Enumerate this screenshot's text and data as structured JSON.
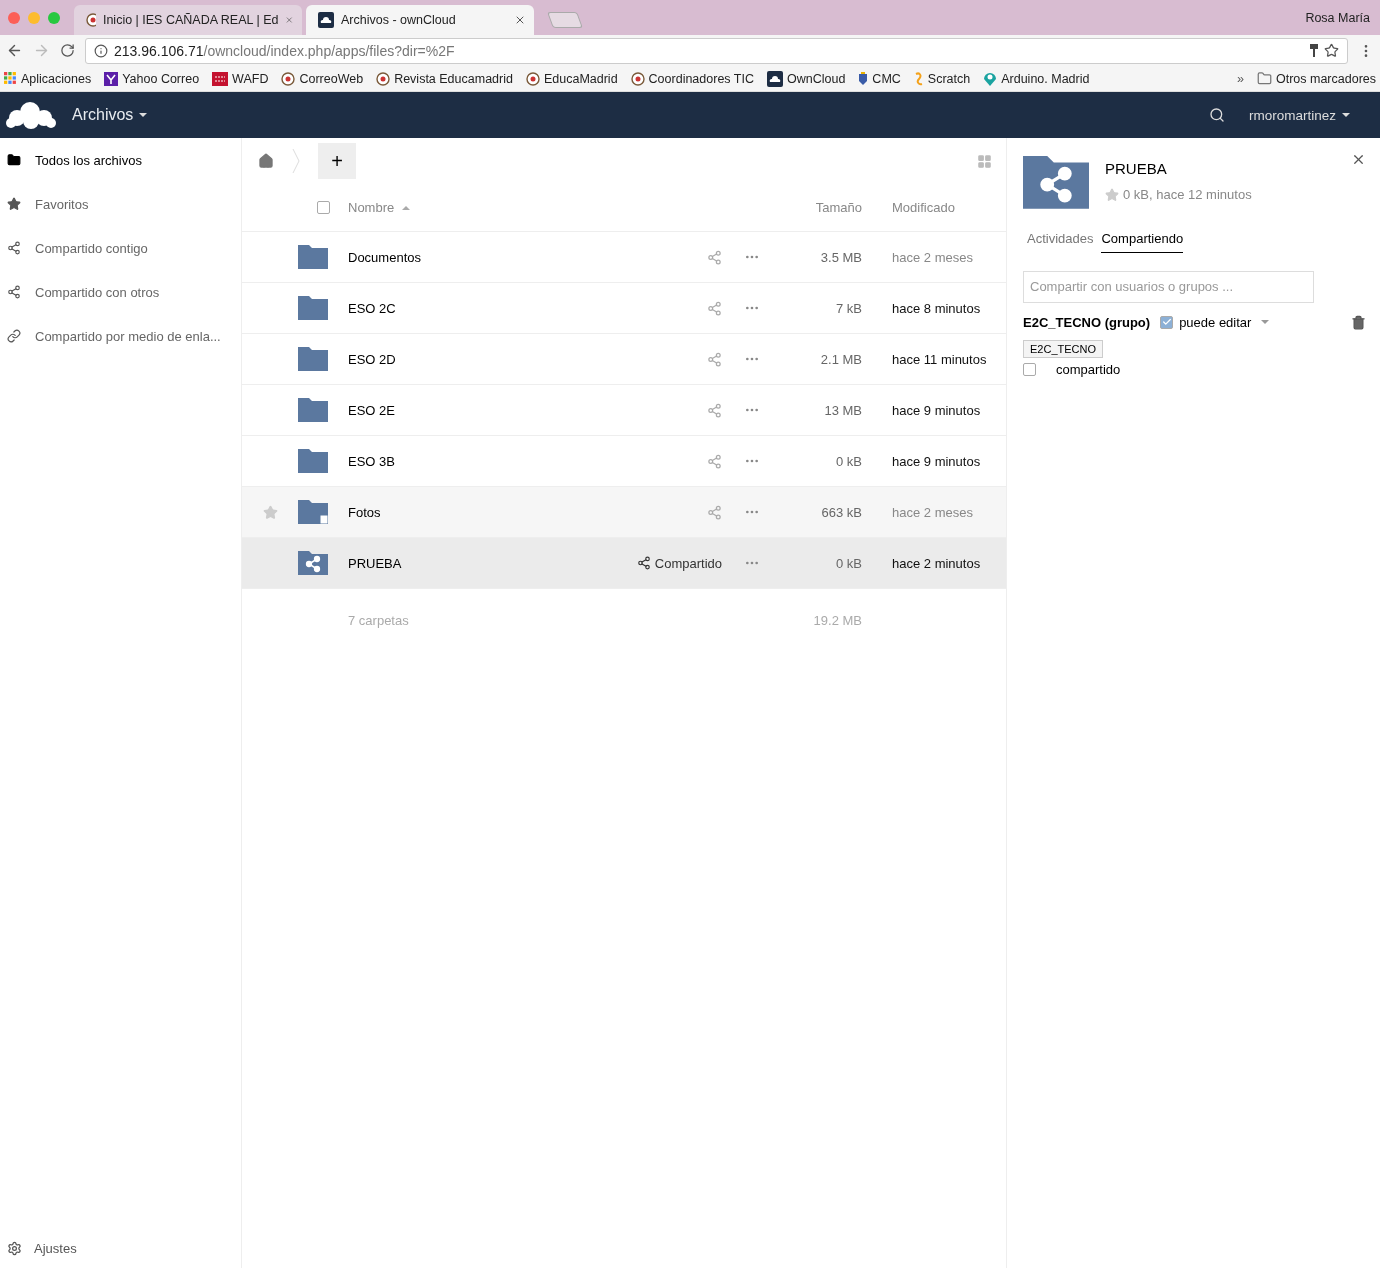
{
  "browser": {
    "tabs": [
      {
        "title": "Inicio | IES CAÑADA REAL | Ed",
        "selected": false
      },
      {
        "title": "Archivos - ownCloud",
        "selected": true
      }
    ],
    "profile": "Rosa María",
    "address": {
      "host": "213.96.106.71",
      "path": "/owncloud/index.php/apps/files?dir=%2F"
    },
    "bookmarks": [
      "Aplicaciones",
      "Yahoo Correo",
      "WAFD",
      "CorreoWeb",
      "Revista Educamadrid",
      "EducaMadrid",
      "Coordinadores TIC",
      "OwnCloud",
      "CMC",
      "Scratch",
      "Arduino. Madrid"
    ],
    "more": "»",
    "other_bookmarks": "Otros marcadores"
  },
  "app": {
    "title": "Archivos",
    "user": "rmoromartinez"
  },
  "sidebar": {
    "items": [
      {
        "label": "Todos los archivos",
        "selected": true
      },
      {
        "label": "Favoritos",
        "selected": false
      },
      {
        "label": "Compartido contigo",
        "selected": false
      },
      {
        "label": "Compartido con otros",
        "selected": false
      },
      {
        "label": "Compartido por medio de enla...",
        "selected": false
      }
    ],
    "settings": "Ajustes"
  },
  "new_button": "+",
  "table": {
    "select_all": {
      "checked": false
    },
    "columns": [
      "Nombre",
      "Tamaño",
      "Modificado"
    ],
    "rows": [
      {
        "name": "Documentos",
        "kind": "folder",
        "size": "3.5 MB",
        "modified": "hace 2 meses",
        "recent": false,
        "selected": false,
        "hovered": false
      },
      {
        "name": "ESO 2C",
        "kind": "folder",
        "size": "7 kB",
        "modified": "hace 8 minutos",
        "recent": true,
        "selected": false,
        "hovered": false
      },
      {
        "name": "ESO 2D",
        "kind": "folder",
        "size": "2.1 MB",
        "modified": "hace 11 minutos",
        "recent": true,
        "selected": false,
        "hovered": false
      },
      {
        "name": "ESO 2E",
        "kind": "folder",
        "size": "13 MB",
        "modified": "hace 9 minutos",
        "recent": true,
        "selected": false,
        "hovered": false
      },
      {
        "name": "ESO 3B",
        "kind": "folder",
        "size": "0 kB",
        "modified": "hace 9 minutos",
        "recent": true,
        "selected": false,
        "hovered": false
      },
      {
        "name": "Fotos",
        "kind": "external",
        "size": "663 kB",
        "modified": "hace 2 meses",
        "recent": false,
        "selected": false,
        "hovered": true
      },
      {
        "name": "PRUEBA",
        "kind": "shared",
        "size": "0 kB",
        "modified": "hace 2 minutos",
        "recent": true,
        "selected": true,
        "hovered": false,
        "share_label": "Compartido"
      }
    ],
    "summary": {
      "count": "7 carpetas",
      "size": "19.2 MB"
    }
  },
  "details": {
    "name": "PRUEBA",
    "meta": "0 kB, hace 12 minutos",
    "tabs": [
      {
        "label": "Actividades",
        "selected": false
      },
      {
        "label": "Compartiendo",
        "selected": true
      }
    ],
    "share_field": {
      "placeholder": "Compartir con usuarios o grupos ..."
    },
    "shares": [
      {
        "name": "E2C_TECNO (grupo)",
        "permission": "puede editar",
        "checked": true
      }
    ],
    "link_share": {
      "label": "compartido",
      "checked": false
    },
    "tooltip": "E2C_TECNO"
  }
}
